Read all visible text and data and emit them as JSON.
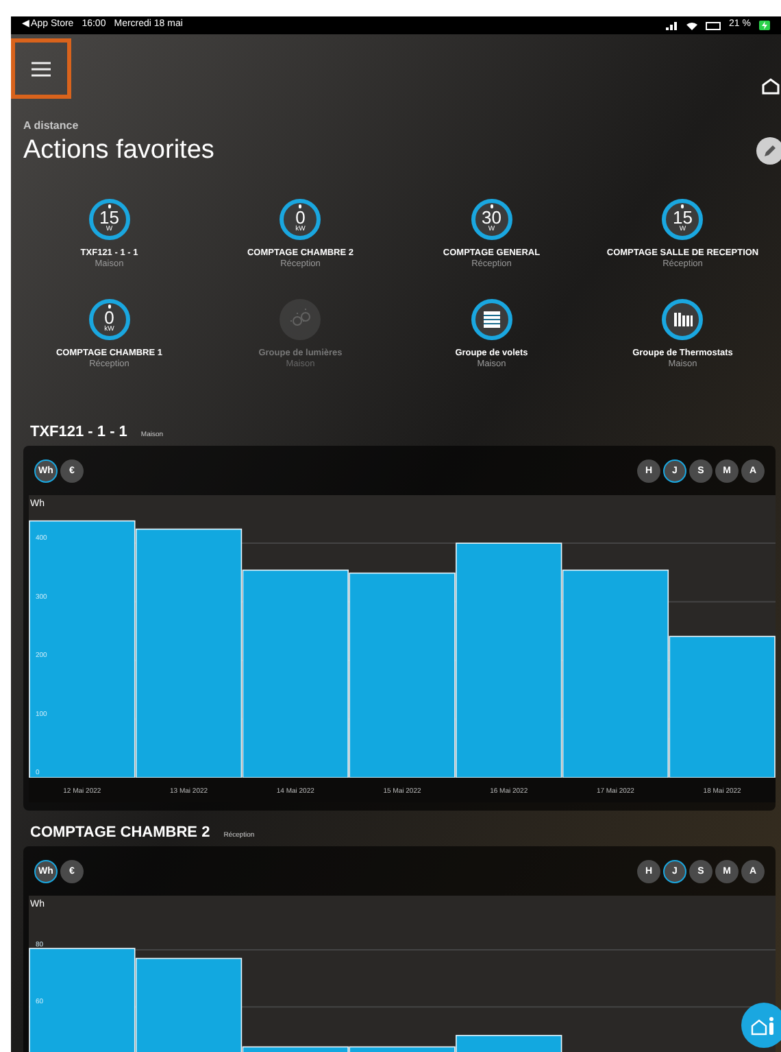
{
  "status_bar": {
    "back": "◀ App Store",
    "time": "16:00",
    "date": "Mercredi 18 mai",
    "battery": "21 %"
  },
  "header": {
    "subtitle": "A distance",
    "title": "Actions favorites"
  },
  "favorites": [
    {
      "kind": "meter",
      "value": "15",
      "unit": "W",
      "name": "TXF121 - 1 - 1",
      "room": "Maison",
      "disabled": false
    },
    {
      "kind": "meter",
      "value": "0",
      "unit": "kW",
      "name": "COMPTAGE CHAMBRE 2",
      "room": "Réception",
      "disabled": false
    },
    {
      "kind": "meter",
      "value": "30",
      "unit": "W",
      "name": "COMPTAGE GENERAL",
      "room": "Réception",
      "disabled": false
    },
    {
      "kind": "meter",
      "value": "15",
      "unit": "W",
      "name": "COMPTAGE SALLE DE RECEPTION",
      "room": "Réception",
      "disabled": false
    },
    {
      "kind": "meter",
      "value": "0",
      "unit": "kW",
      "name": "COMPTAGE CHAMBRE 1",
      "room": "Réception",
      "disabled": false
    },
    {
      "kind": "lights",
      "name": "Groupe de lumières",
      "room": "Maison",
      "disabled": true
    },
    {
      "kind": "shutters",
      "name": "Groupe de volets",
      "room": "Maison",
      "disabled": false
    },
    {
      "kind": "thermostats",
      "name": "Groupe de Thermostats",
      "room": "Maison",
      "disabled": false
    }
  ],
  "sections": [
    {
      "title": "TXF121 - 1 - 1",
      "room": "Maison",
      "units": [
        {
          "label": "Wh",
          "selected": true
        },
        {
          "label": "€",
          "selected": false
        }
      ],
      "periods": [
        {
          "label": "H",
          "selected": false
        },
        {
          "label": "J",
          "selected": true
        },
        {
          "label": "S",
          "selected": false
        },
        {
          "label": "M",
          "selected": false
        },
        {
          "label": "A",
          "selected": false
        }
      ],
      "chart_data": {
        "type": "bar",
        "ylabel": "Wh",
        "categories": [
          "12 Mai 2022",
          "13 Mai 2022",
          "14 Mai 2022",
          "15 Mai 2022",
          "16 Mai 2022",
          "17 Mai 2022",
          "18 Mai 2022"
        ],
        "series": [
          {
            "color": "#12a8e0",
            "values": [
              438,
              424,
              354,
              349,
              400,
              354,
              241
            ]
          }
        ],
        "grid": true,
        "ylim": [
          0,
          482
        ],
        "yticks": [
          0,
          100,
          200,
          300,
          400
        ]
      }
    },
    {
      "title": "COMPTAGE CHAMBRE 2",
      "room": "Réception",
      "units": [
        {
          "label": "Wh",
          "selected": true
        },
        {
          "label": "€",
          "selected": false
        }
      ],
      "periods": [
        {
          "label": "H",
          "selected": false
        },
        {
          "label": "J",
          "selected": true
        },
        {
          "label": "S",
          "selected": false
        },
        {
          "label": "M",
          "selected": false
        },
        {
          "label": "A",
          "selected": false
        }
      ],
      "chart_data": {
        "type": "bar",
        "ylabel": "Wh",
        "series": [
          {
            "color": "#12a8e0",
            "values": [
              80.5,
              77,
              46,
              46,
              50,
              null,
              null
            ]
          }
        ],
        "grid": true,
        "ylim": [
          0,
          99
        ],
        "yticks": [
          60,
          80
        ]
      }
    }
  ]
}
